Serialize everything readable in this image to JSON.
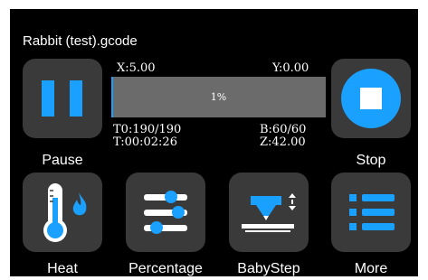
{
  "file": {
    "name": "Rabbit (test).gcode"
  },
  "position": {
    "x": "X:5.00",
    "y": "Y:0.00",
    "z": "Z:42.00"
  },
  "temperatures": {
    "tool0": "T0:190/190",
    "bed": "B:60/60"
  },
  "elapsed": "T:00:02:26",
  "progress": {
    "text": "1%",
    "fraction": 0.01
  },
  "buttons": {
    "pause": "Pause",
    "stop": "Stop",
    "heat": "Heat",
    "percentage": "Percentage",
    "babystep": "BabyStep",
    "more": "More"
  },
  "icons": {
    "pause": "pause-icon",
    "stop": "stop-icon",
    "heat": "thermometer-flame-icon",
    "percentage": "sliders-icon",
    "babystep": "nozzle-icon",
    "more": "list-icon"
  },
  "colors": {
    "accent": "#1aa0ff",
    "tile": "#3a3a3a",
    "background": "#000000"
  }
}
